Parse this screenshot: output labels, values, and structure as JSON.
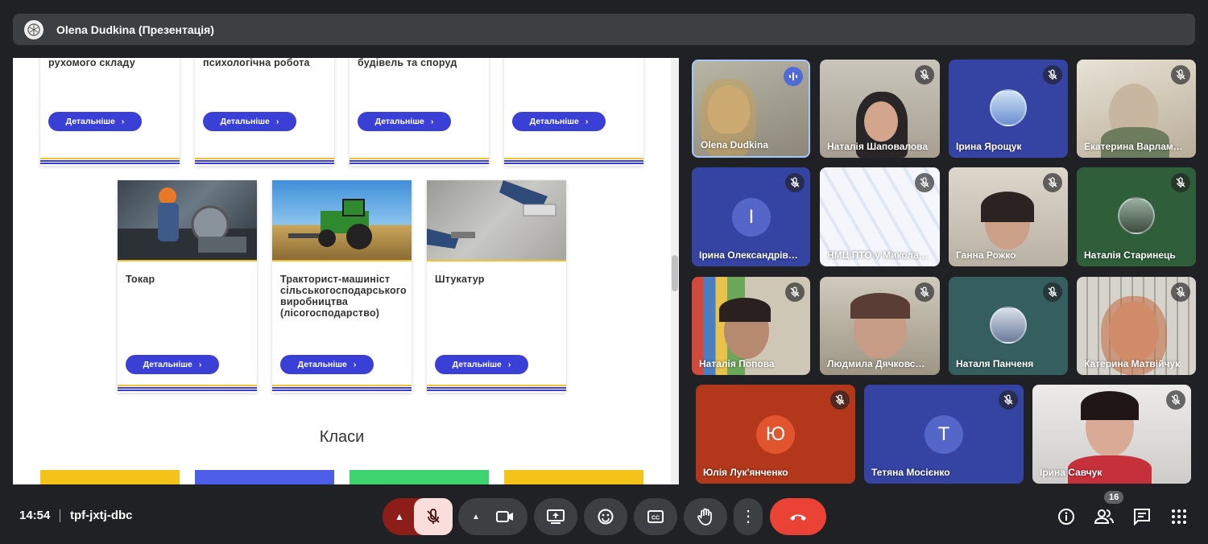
{
  "header": {
    "presenter_title": "Olena Dudkina (Презентація)"
  },
  "presentation": {
    "top_cards": [
      {
        "title": "рухомого складу",
        "button": "Детальніше"
      },
      {
        "title": "психологічна робота",
        "button": "Детальніше"
      },
      {
        "title": "будівель та споруд",
        "button": "Детальніше"
      },
      {
        "title": "",
        "button": "Детальніше"
      }
    ],
    "cards": [
      {
        "title": "Токар",
        "button": "Детальніше"
      },
      {
        "title": "Тракторист-машиніст сільськогосподарського виробництва (лісогосподарство)",
        "button": "Детальніше"
      },
      {
        "title": "Штукатур",
        "button": "Детальніше"
      }
    ],
    "section_heading": "Класи"
  },
  "participants": [
    {
      "name": "Olena Dudkina",
      "speaking": true
    },
    {
      "name": "Наталія Шаповалова",
      "muted": true
    },
    {
      "name": "Ірина Ярощук",
      "muted": true
    },
    {
      "name": "Екатерина Варлам…",
      "muted": true
    },
    {
      "name": "Ірина Олександрів…",
      "muted": true,
      "initial": "І"
    },
    {
      "name": "НМЦ ПТО у Микола…",
      "muted": true
    },
    {
      "name": "Ганна Рожко",
      "muted": true
    },
    {
      "name": "Наталія Старинець",
      "muted": true
    },
    {
      "name": "Наталія Попова",
      "muted": true
    },
    {
      "name": "Людмила Дячковс…",
      "muted": true
    },
    {
      "name": "Наталя Панченя",
      "muted": true
    },
    {
      "name": "Катерина Матвійчук",
      "muted": true
    },
    {
      "name": "Юлія Лук'янченко",
      "muted": true,
      "initial": "Ю"
    },
    {
      "name": "Тетяна Мосієнко",
      "muted": true,
      "initial": "Т"
    },
    {
      "name": "Ірина Савчук",
      "muted": true
    }
  ],
  "meeting": {
    "time": "14:54",
    "code": "tpf-jxtj-dbc",
    "participant_count": "16"
  },
  "colors": {
    "accent_blue": "#3a3fd6",
    "end_call": "#ea4335",
    "mic_off_bg": "#f9dedc",
    "tile_bg": "#3c4043"
  }
}
